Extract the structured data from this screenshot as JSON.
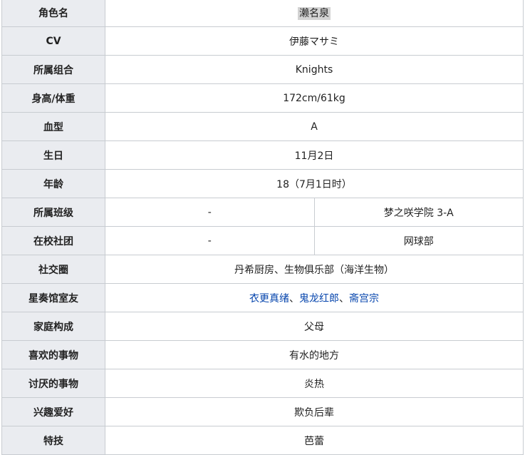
{
  "rows": {
    "name": {
      "label": "角色名",
      "value": "濑名泉"
    },
    "cv": {
      "label": "CV",
      "value": "伊藤マサミ"
    },
    "unit": {
      "label": "所属组合",
      "value": "Knights"
    },
    "height_weight": {
      "label": "身高/体重",
      "value": "172cm/61kg"
    },
    "blood": {
      "label": "血型",
      "value": "A"
    },
    "birthday": {
      "label": "生日",
      "value": "11月2日"
    },
    "age": {
      "label": "年龄",
      "value": "18（7月1日时）"
    },
    "class": {
      "label": "所属班级",
      "value_left": "-",
      "value_right": "梦之咲学院 3-A"
    },
    "club": {
      "label": "在校社团",
      "value_left": "-",
      "value_right": "网球部"
    },
    "circle": {
      "label": "社交圈",
      "value": "丹希厨房、生物俱乐部（海洋生物）"
    },
    "roommates": {
      "label": "星奏馆室友",
      "links": [
        "衣更真绪",
        "鬼龙红郎",
        "斋宫宗"
      ],
      "separator": "、"
    },
    "family": {
      "label": "家庭构成",
      "value": "父母"
    },
    "likes": {
      "label": "喜欢的事物",
      "value": "有水的地方"
    },
    "dislikes": {
      "label": "讨厌的事物",
      "value": "炎热"
    },
    "hobby": {
      "label": "兴趣爱好",
      "value": "欺负后辈"
    },
    "skill": {
      "label": "特技",
      "value": "芭蕾"
    }
  },
  "colors": {
    "header_bg": "#eaecf0",
    "border": "#c8ccd1",
    "link": "#0645ad",
    "highlight": "#d3d3d3"
  }
}
